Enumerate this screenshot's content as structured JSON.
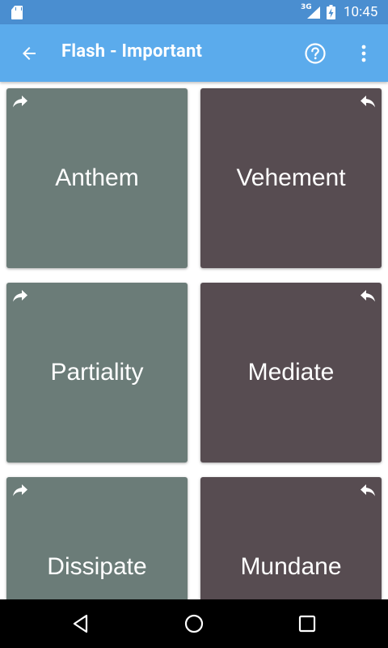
{
  "status_bar": {
    "time": "10:45",
    "network": "3G",
    "icons": [
      "sd-card-icon",
      "signal-icon",
      "battery-charging-icon"
    ]
  },
  "app_bar": {
    "title": "Flash - Important",
    "icons": [
      "back-arrow-icon",
      "help-icon",
      "more-vert-icon"
    ]
  },
  "colors": {
    "status_bar": "#4a8ed0",
    "app_bar": "#5babec",
    "card_left": "#6b7c78",
    "card_right": "#574c51",
    "nav_bar": "#000000"
  },
  "cards": [
    {
      "word": "Anthem",
      "icon": "forward-arrow-icon"
    },
    {
      "word": "Vehement",
      "icon": "reply-arrow-icon"
    },
    {
      "word": "Partiality",
      "icon": "forward-arrow-icon"
    },
    {
      "word": "Mediate",
      "icon": "reply-arrow-icon"
    },
    {
      "word": "Dissipate",
      "icon": "forward-arrow-icon"
    },
    {
      "word": "Mundane",
      "icon": "reply-arrow-icon"
    }
  ],
  "nav_bar": {
    "icons": [
      "nav-back-icon",
      "nav-home-icon",
      "nav-recents-icon"
    ]
  }
}
